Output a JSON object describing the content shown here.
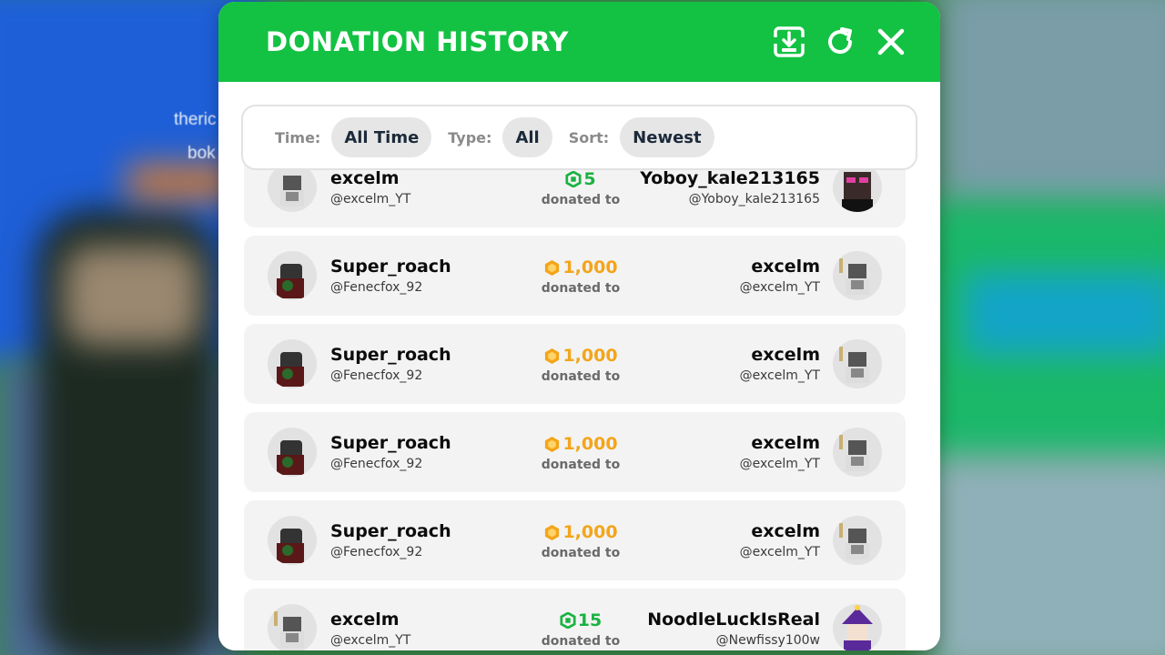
{
  "background": {
    "left_text_1": "theric",
    "left_text_2": "bok"
  },
  "panel": {
    "title": "DONATION HISTORY",
    "icons": [
      "download-icon",
      "refresh-icon",
      "close-icon"
    ]
  },
  "filters": {
    "time_label": "Time:",
    "time_value": "All Time",
    "type_label": "Type:",
    "type_value": "All",
    "sort_label": "Sort:",
    "sort_value": "Newest"
  },
  "donated_text": "donated to",
  "rows": [
    {
      "from_name": "excelm",
      "from_handle": "@excelm_YT",
      "amount": "5",
      "currency": "robux",
      "to_name": "Yoboy_kale213165",
      "to_handle": "@Yoboy_kale213165"
    },
    {
      "from_name": "Super_roach",
      "from_handle": "@Fenecfox_92",
      "amount": "1,000",
      "currency": "gold",
      "to_name": "excelm",
      "to_handle": "@excelm_YT"
    },
    {
      "from_name": "Super_roach",
      "from_handle": "@Fenecfox_92",
      "amount": "1,000",
      "currency": "gold",
      "to_name": "excelm",
      "to_handle": "@excelm_YT"
    },
    {
      "from_name": "Super_roach",
      "from_handle": "@Fenecfox_92",
      "amount": "1,000",
      "currency": "gold",
      "to_name": "excelm",
      "to_handle": "@excelm_YT"
    },
    {
      "from_name": "Super_roach",
      "from_handle": "@Fenecfox_92",
      "amount": "1,000",
      "currency": "gold",
      "to_name": "excelm",
      "to_handle": "@excelm_YT"
    },
    {
      "from_name": "excelm",
      "from_handle": "@excelm_YT",
      "amount": "15",
      "currency": "robux",
      "to_name": "NoodleLuckIsReal",
      "to_handle": "@Newfissy100w"
    }
  ],
  "colors": {
    "header_green": "#13c243",
    "gold": "#f3a51a",
    "robux_green": "#19b341"
  }
}
